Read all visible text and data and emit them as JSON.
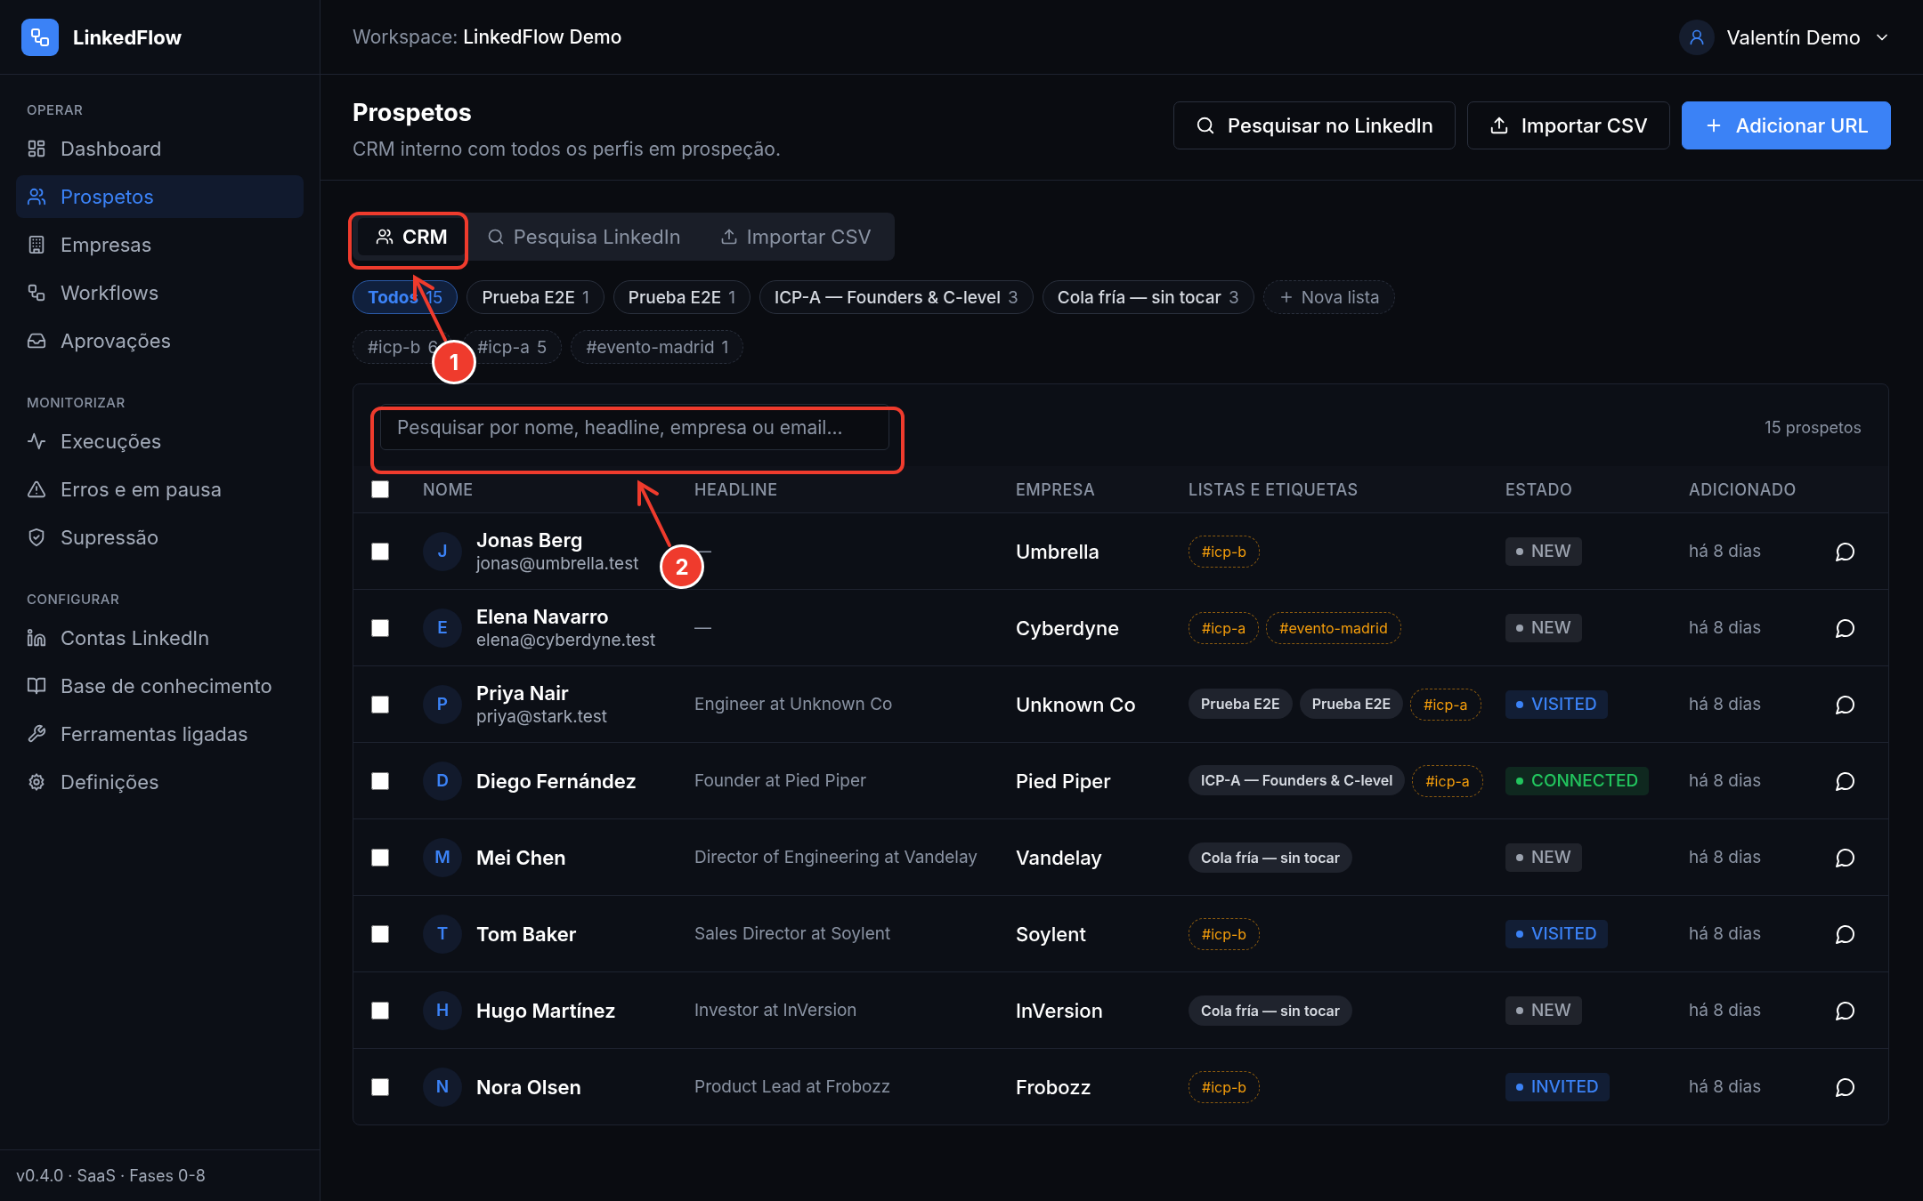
{
  "sidebar": {
    "brand": "LinkedFlow",
    "sections": [
      {
        "title": "OPERAR",
        "items": [
          {
            "label": "Dashboard",
            "selected": false
          },
          {
            "label": "Prospetos",
            "selected": true
          },
          {
            "label": "Empresas",
            "selected": false
          },
          {
            "label": "Workflows",
            "selected": false
          },
          {
            "label": "Aprovações",
            "selected": false
          }
        ]
      },
      {
        "title": "MONITORIZAR",
        "items": [
          {
            "label": "Execuções",
            "selected": false
          },
          {
            "label": "Erros e em pausa",
            "selected": false
          },
          {
            "label": "Supressão",
            "selected": false
          }
        ]
      },
      {
        "title": "CONFIGURAR",
        "items": [
          {
            "label": "Contas LinkedIn",
            "selected": false
          },
          {
            "label": "Base de conhecimento",
            "selected": false
          },
          {
            "label": "Ferramentas ligadas",
            "selected": false
          },
          {
            "label": "Definições",
            "selected": false
          }
        ]
      }
    ],
    "footer": "v0.4.0 · SaaS · Fases 0-8"
  },
  "topbar": {
    "workspace_label": "Workspace:",
    "workspace_name": "LinkedFlow Demo",
    "user": "Valentín Demo"
  },
  "page": {
    "title": "Prospetos",
    "subtitle": "CRM interno com todos os perfis em prospeção.",
    "actions": [
      {
        "label": "Pesquisar no LinkedIn",
        "kind": "secondary"
      },
      {
        "label": "Importar CSV",
        "kind": "secondary"
      },
      {
        "label": "Adicionar URL",
        "kind": "primary"
      }
    ]
  },
  "tabs": [
    {
      "label": "CRM",
      "selected": true
    },
    {
      "label": "Pesquisa LinkedIn",
      "selected": false
    },
    {
      "label": "Importar CSV",
      "selected": false
    }
  ],
  "lists": [
    {
      "label": "Todos",
      "count": "15",
      "selected": true
    },
    {
      "label": "Prueba E2E",
      "count": "1",
      "selected": false
    },
    {
      "label": "Prueba E2E",
      "count": "1",
      "selected": false
    },
    {
      "label": "ICP-A — Founders & C-level",
      "count": "3",
      "selected": false
    },
    {
      "label": "Cola fría — sin tocar",
      "count": "3",
      "selected": false
    }
  ],
  "new_list": "Nova lista",
  "tags": [
    {
      "label": "#icp-b",
      "count": "6"
    },
    {
      "label": "#icp-a",
      "count": "5"
    },
    {
      "label": "#evento-madrid",
      "count": "1"
    }
  ],
  "search": {
    "placeholder": "Pesquisar por nome, headline, empresa ou email..."
  },
  "total": "15 prospetos",
  "table": {
    "select_all_checked": false,
    "columns": [
      "NOME",
      "HEADLINE",
      "EMPRESA",
      "LISTAS E ETIQUETAS",
      "ESTADO",
      "ADICIONADO"
    ],
    "rows": [
      {
        "checked": false,
        "initial": "J",
        "name": "Jonas Berg",
        "email": "jonas@umbrella.test",
        "headline": "—",
        "company": "Umbrella",
        "labels": [
          {
            "kind": "tag",
            "text": "#icp-b"
          }
        ],
        "status": {
          "text": "NEW",
          "color": "#9ca3af"
        },
        "added": "há 8 dias"
      },
      {
        "checked": false,
        "initial": "E",
        "name": "Elena Navarro",
        "email": "elena@cyberdyne.test",
        "headline": "—",
        "company": "Cyberdyne",
        "labels": [
          {
            "kind": "tag",
            "text": "#icp-a"
          },
          {
            "kind": "tag",
            "text": "#evento-madrid"
          }
        ],
        "status": {
          "text": "NEW",
          "color": "#9ca3af"
        },
        "added": "há 8 dias"
      },
      {
        "checked": false,
        "initial": "P",
        "name": "Priya Nair",
        "email": "priya@stark.test",
        "headline": "Engineer at Unknown Co",
        "company": "Unknown Co",
        "labels": [
          {
            "kind": "list",
            "text": "Prueba E2E"
          },
          {
            "kind": "list",
            "text": "Prueba E2E"
          },
          {
            "kind": "tag",
            "text": "#icp-a"
          }
        ],
        "status": {
          "text": "VISITED",
          "color": "#3b82f6"
        },
        "added": "há 8 dias"
      },
      {
        "checked": false,
        "initial": "D",
        "name": "Diego Fernández",
        "headline": "Founder at Pied Piper",
        "company": "Pied Piper",
        "labels": [
          {
            "kind": "list",
            "text": "ICP-A — Founders & C-level"
          },
          {
            "kind": "tag",
            "text": "#icp-a"
          }
        ],
        "status": {
          "text": "CONNECTED",
          "color": "#22c55e"
        },
        "added": "há 8 dias"
      },
      {
        "checked": false,
        "initial": "M",
        "name": "Mei Chen",
        "headline": "Director of Engineering at Vandelay",
        "company": "Vandelay",
        "labels": [
          {
            "kind": "list",
            "text": "Cola fría — sin tocar"
          }
        ],
        "status": {
          "text": "NEW",
          "color": "#9ca3af"
        },
        "added": "há 8 dias"
      },
      {
        "checked": false,
        "initial": "T",
        "name": "Tom Baker",
        "headline": "Sales Director at Soylent",
        "company": "Soylent",
        "labels": [
          {
            "kind": "tag",
            "text": "#icp-b"
          }
        ],
        "status": {
          "text": "VISITED",
          "color": "#3b82f6"
        },
        "added": "há 8 dias"
      },
      {
        "checked": false,
        "initial": "H",
        "name": "Hugo Martínez",
        "headline": "Investor at InVersion",
        "company": "InVersion",
        "labels": [
          {
            "kind": "list",
            "text": "Cola fría — sin tocar"
          }
        ],
        "status": {
          "text": "NEW",
          "color": "#9ca3af"
        },
        "added": "há 8 dias"
      },
      {
        "checked": false,
        "initial": "N",
        "name": "Nora Olsen",
        "headline": "Product Lead at Frobozz",
        "company": "Frobozz",
        "labels": [
          {
            "kind": "tag",
            "text": "#icp-b"
          }
        ],
        "status": {
          "text": "INVITED",
          "color": "#3b82f6"
        },
        "added": "há 8 dias"
      }
    ]
  },
  "annotations": [
    {
      "number": "1"
    },
    {
      "number": "2"
    }
  ]
}
